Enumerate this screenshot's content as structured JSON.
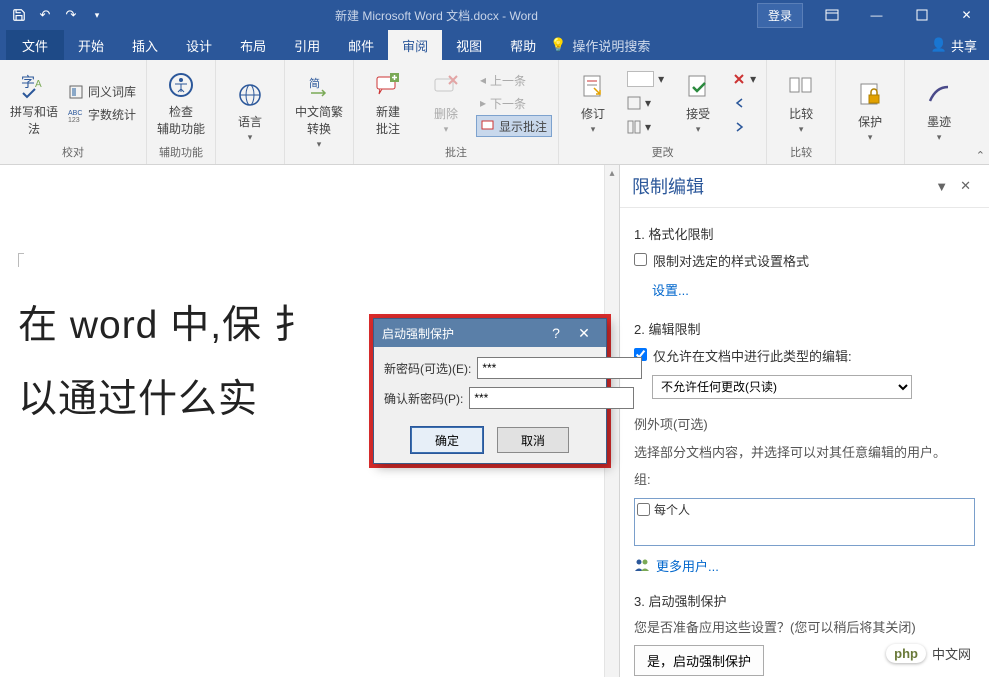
{
  "title": "新建 Microsoft Word 文档.docx - Word",
  "login": "登录",
  "tabs": {
    "file": "文件",
    "items": [
      "开始",
      "插入",
      "设计",
      "布局",
      "引用",
      "邮件",
      "审阅",
      "视图",
      "帮助"
    ],
    "active": "审阅",
    "tell_me": "操作说明搜索",
    "share": "共享"
  },
  "ribbon": {
    "proofing": {
      "spelling": "拼写和语法",
      "thesaurus": "同义词库",
      "wordcount": "字数统计",
      "label": "校对"
    },
    "accessibility": {
      "btn": "检查\n辅助功能",
      "label": "辅助功能"
    },
    "language": {
      "btn": "语言",
      "label": ""
    },
    "chinese": {
      "btn": "中文简繁\n转换",
      "label": ""
    },
    "comments": {
      "new": "新建\n批注",
      "delete": "删除",
      "prev": "上一条",
      "next": "下一条",
      "show": "显示批注",
      "label": "批注"
    },
    "tracking": {
      "btn": "修订",
      "accept": "接受",
      "label": "更改"
    },
    "compare": {
      "btn": "比较",
      "label": "比较"
    },
    "protect": {
      "btn": "保护"
    },
    "ink": {
      "btn": "墨迹"
    }
  },
  "document": {
    "line1": "在 word 中,保 扌",
    "line2": "以通过什么实 "
  },
  "dialog": {
    "title": "启动强制保护",
    "new_pwd_label": "新密码(可选)(E):",
    "new_pwd_value": "***",
    "confirm_pwd_label": "确认新密码(P):",
    "confirm_pwd_value": "***",
    "ok": "确定",
    "cancel": "取消"
  },
  "pane": {
    "title": "限制编辑",
    "s1": "1. 格式化限制",
    "s1_chk": "限制对选定的样式设置格式",
    "s1_link": "设置...",
    "s2": "2. 编辑限制",
    "s2_chk": "仅允许在文档中进行此类型的编辑:",
    "s2_select": "不允许任何更改(只读)",
    "s2_exceptions": "例外项(可选)",
    "s2_exceptions_text": "选择部分文档内容，并选择可以对其任意编辑的用户。",
    "s2_group": "组:",
    "s2_group_opt": "每个人",
    "s2_more_users": "更多用户...",
    "s3": "3. 启动强制保护",
    "s3_text": "您是否准备应用这些设置？(您可以稍后将其关闭)",
    "s3_btn": "是，启动强制保护"
  },
  "watermark": {
    "brand": "php",
    "text": "中文网"
  }
}
